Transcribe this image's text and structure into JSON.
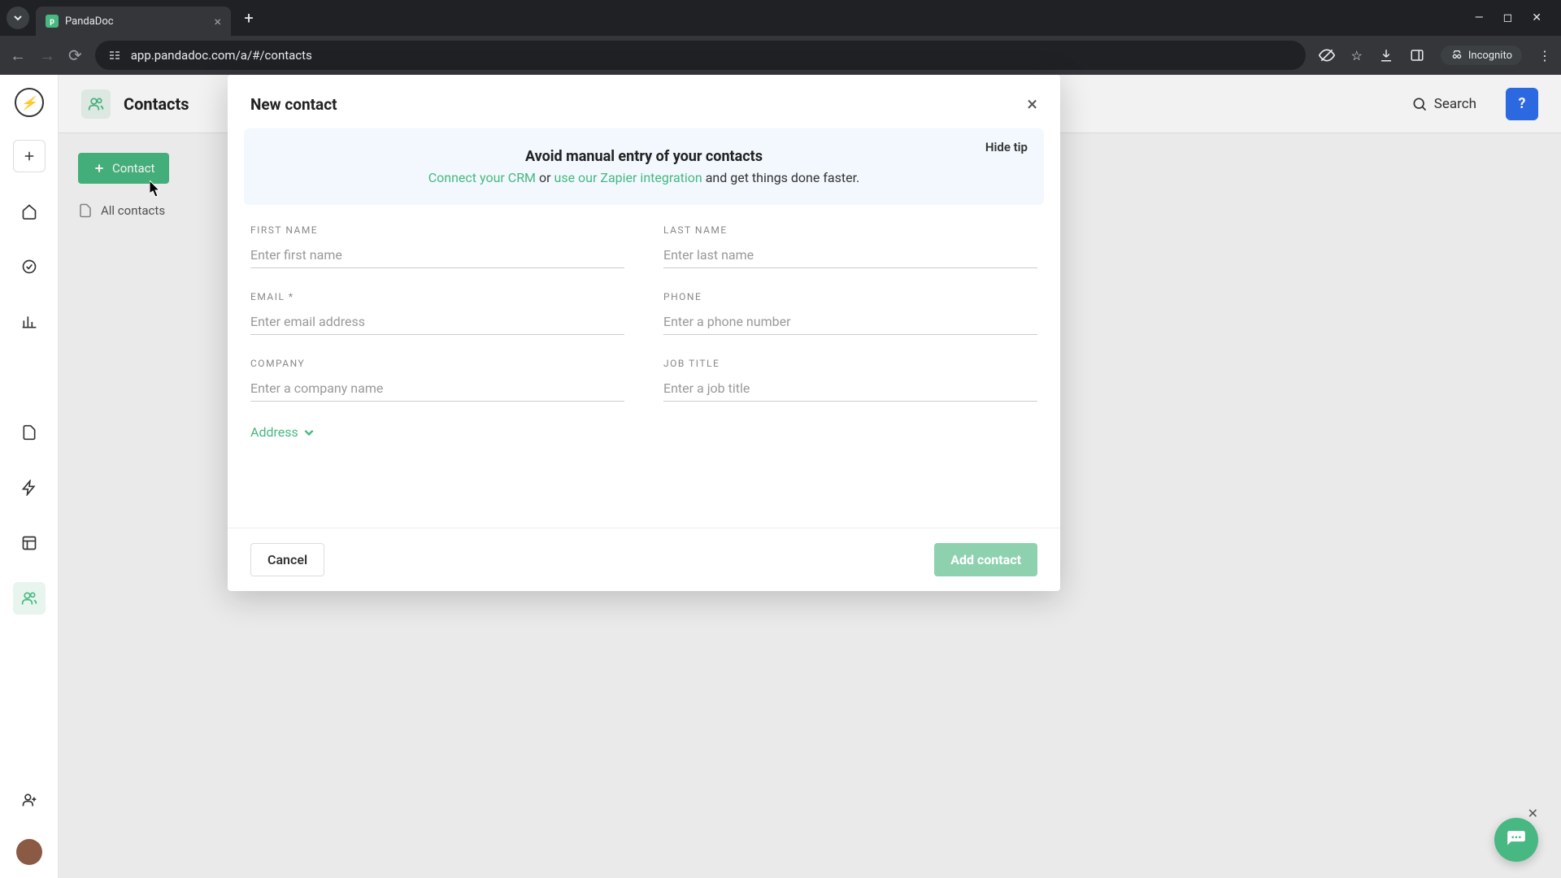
{
  "browser": {
    "tab_title": "PandaDoc",
    "url": "app.pandadoc.com/a/#/contacts",
    "incognito_label": "Incognito"
  },
  "header": {
    "page_title": "Contacts",
    "search_label": "Search"
  },
  "sidebar_list": {
    "contact_button": "Contact",
    "all_contacts": "All contacts"
  },
  "modal": {
    "title": "New contact",
    "hide_tip": "Hide tip",
    "tip_title": "Avoid manual entry of your contacts",
    "tip_link1": "Connect your CRM",
    "tip_or": " or ",
    "tip_link2": "use our Zapier integration",
    "tip_rest": " and get things done faster.",
    "fields": {
      "first_name": {
        "label": "FIRST NAME",
        "placeholder": "Enter first name"
      },
      "last_name": {
        "label": "LAST NAME",
        "placeholder": "Enter last name"
      },
      "email": {
        "label": "EMAIL *",
        "placeholder": "Enter email address"
      },
      "phone": {
        "label": "PHONE",
        "placeholder": "Enter a phone number"
      },
      "company": {
        "label": "COMPANY",
        "placeholder": "Enter a company name"
      },
      "job_title": {
        "label": "JOB TITLE",
        "placeholder": "Enter a job title"
      }
    },
    "address_toggle": "Address",
    "cancel": "Cancel",
    "add": "Add contact"
  }
}
